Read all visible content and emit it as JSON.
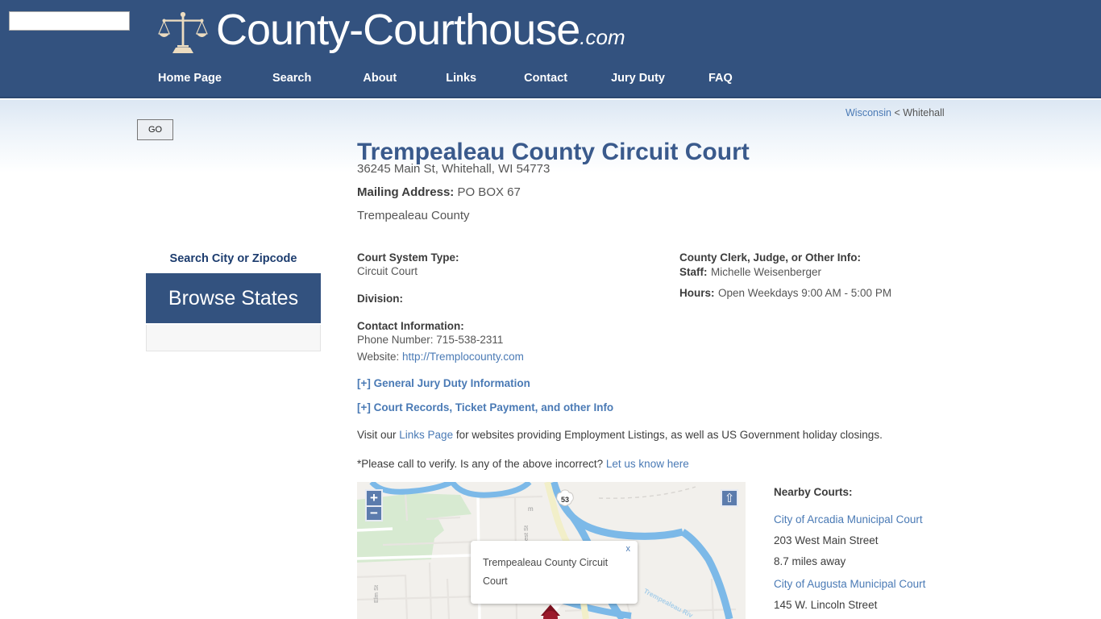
{
  "header": {
    "logo_icon": "scales-of-justice-icon",
    "brand_name": "County-Courthouse",
    "brand_tld": ".com",
    "bg_color": "#33527f",
    "nav": [
      {
        "label": "Home Page"
      },
      {
        "label": "Search"
      },
      {
        "label": "About"
      },
      {
        "label": "Links"
      },
      {
        "label": "Contact"
      },
      {
        "label": "Jury Duty"
      },
      {
        "label": "FAQ"
      }
    ]
  },
  "sidebar": {
    "search_value": "",
    "search_placeholder": "",
    "go_label": "GO",
    "search_caption": "Search City or Zipcode",
    "browse_states_label": "Browse States"
  },
  "breadcrumb": {
    "state": "Wisconsin",
    "separator": "<",
    "city": "Whitehall"
  },
  "court": {
    "title": "Trempealeau County Circuit Court",
    "street_address": "36245 Main St, Whitehall, WI 54773",
    "mailing_label": "Mailing Address:",
    "mailing_value": "PO BOX 67",
    "county": "Trempealeau County",
    "system_type_label": "Court System Type:",
    "system_type_value": "Circuit Court",
    "division_label": "Division:",
    "division_value": "",
    "contact_label": "Contact Information:",
    "phone_line": "Phone Number: 715-538-2311",
    "website_prefix": "Website:",
    "website_url": "http://Tremplocounty.com",
    "clerk_label": "County Clerk, Judge, or Other Info:",
    "staff_label": "Staff:",
    "staff_value": "Michelle Weisenberger",
    "hours_label": "Hours:",
    "hours_value": "Open Weekdays 9:00 AM - 5:00 PM"
  },
  "expandables": [
    {
      "label": "[+] General Jury Duty Information"
    },
    {
      "label": "[+] Court Records, Ticket Payment, and other Info"
    }
  ],
  "notes": {
    "links_pre": "Visit our ",
    "links_link": "Links Page",
    "links_post": " for websites providing Employment Listings, as well as US Government holiday closings.",
    "verify_pre": "*Please call to verify. Is any of the above incorrect? ",
    "verify_link": "Let us know here"
  },
  "map": {
    "zoom_in_label": "+",
    "zoom_out_label": "−",
    "fullscreen_icon": "up-arrow-icon",
    "fullscreen_label": "⇧",
    "popup_text": "Trempealeau County Circuit Court",
    "popup_close_label": "x",
    "highway_shield": "53",
    "street_label_west": "West St",
    "street_label_elm": "Elm St",
    "river_label": "Trempealeau Riv",
    "marker_icon": "map-pin-icon",
    "bg_color": "#f2f0ec",
    "park_color": "#d7ead1",
    "water_color": "#7cb9e8"
  },
  "nearby": {
    "title": "Nearby Courts:",
    "items": [
      {
        "name": "City of Arcadia Municipal Court",
        "address": "203 West Main Street",
        "distance": "8.7 miles away"
      },
      {
        "name": "City of Augusta Municipal Court",
        "address": "145 W. Lincoln Street",
        "distance": ""
      }
    ]
  }
}
